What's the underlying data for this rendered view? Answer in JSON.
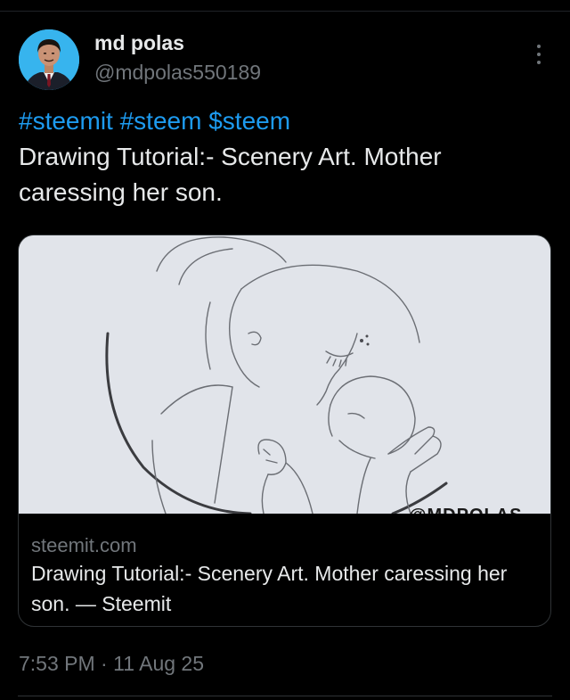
{
  "author": {
    "name": "md polas",
    "handle": "@mdpolas550189"
  },
  "tweet": {
    "hashtags": [
      "#steemit",
      "#steem",
      "$steem"
    ],
    "text": "Drawing Tutorial:- Scenery Art. Mother caressing her son."
  },
  "card": {
    "domain": "steemit.com",
    "title": "Drawing Tutorial:- Scenery Art. Mother caressing her son. — Steemit",
    "watermark": "@MDPOLAS"
  },
  "timestamp": {
    "time": "7:53 PM",
    "separator": "·",
    "date": "11 Aug 25"
  },
  "icons": {
    "more": "more-vertical-icon"
  },
  "colors": {
    "background": "#000000",
    "accent": "#1d9bf0",
    "text": "#e7e9ea",
    "muted": "#71767b",
    "border": "#2f3336"
  }
}
